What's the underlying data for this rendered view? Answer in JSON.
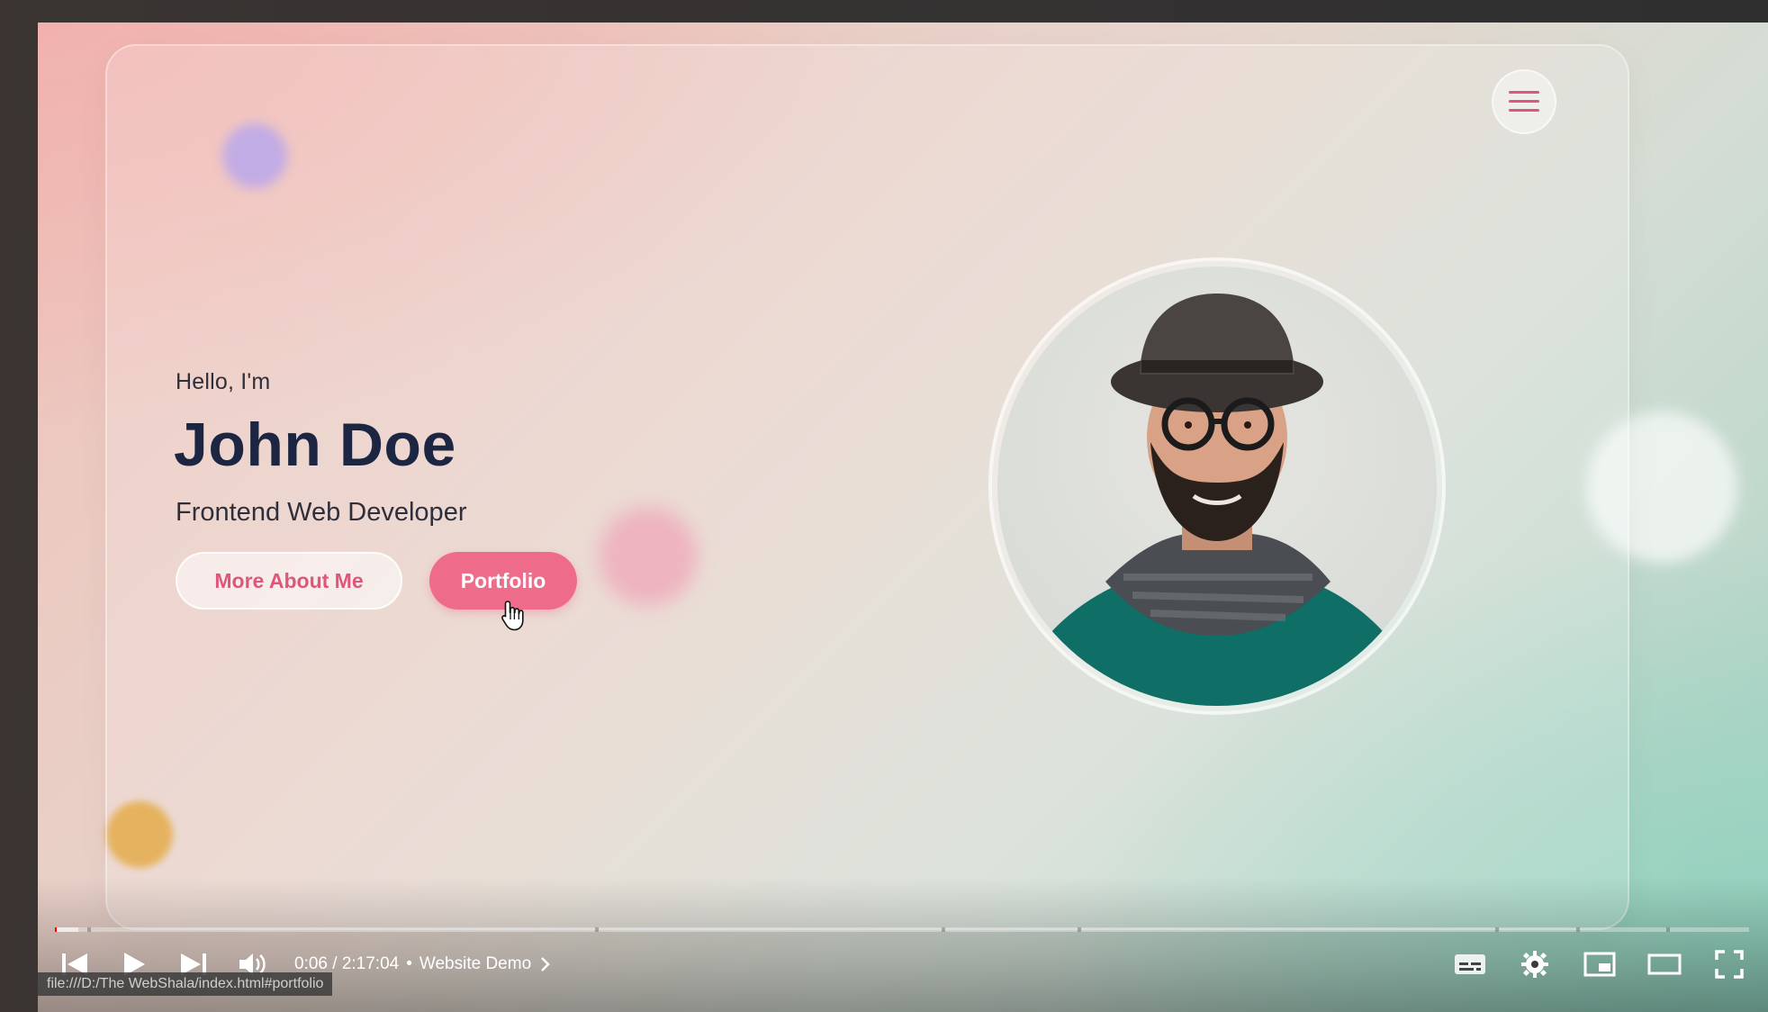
{
  "hero": {
    "greeting": "Hello, I'm",
    "name": "John Doe",
    "role": "Frontend Web Developer",
    "button_primary": "More About Me",
    "button_secondary": "Portfolio"
  },
  "icons": {
    "menu": "hamburger-menu-icon",
    "cursor": "hand-pointer-icon"
  },
  "colors": {
    "accent": "#ee6b8a",
    "accent_text": "#e0567a",
    "heading": "#1c2541",
    "player_progress": "#ff0000"
  },
  "player": {
    "current_time": "0:06",
    "separator": "/",
    "duration": "2:17:04",
    "chapter": "Website Demo",
    "progress_fraction": 0.0007,
    "loaded_fraction": 0.014
  },
  "status_bar": {
    "url": "file:///D:/The WebShala/index.html#portfolio"
  }
}
